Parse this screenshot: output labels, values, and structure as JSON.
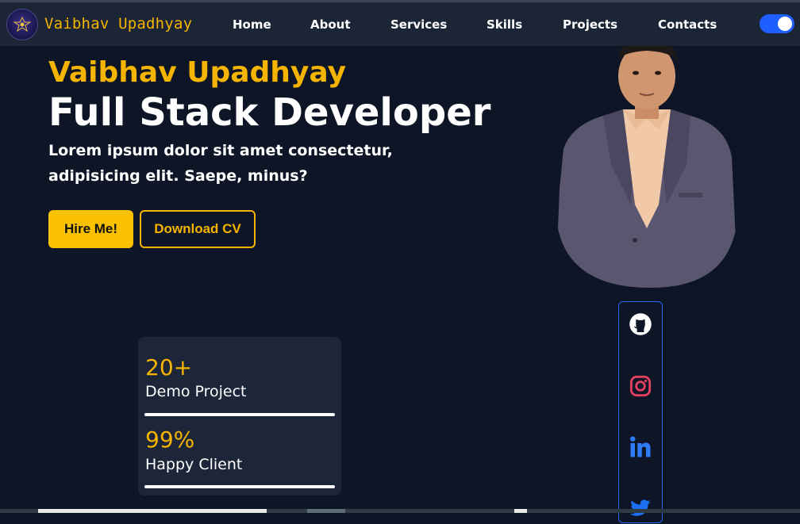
{
  "navbar": {
    "logo_icon": "emblem-logo",
    "brand": "Vaibhav Upadhyay",
    "links": [
      "Home",
      "About",
      "Services",
      "Skills",
      "Projects",
      "Contacts"
    ],
    "theme_toggle": {
      "on": true,
      "color": "#1f5eff"
    }
  },
  "hero": {
    "name": "Vaibhav Upadhyay",
    "title": "Full Stack Developer",
    "description": "Lorem ipsum dolor sit amet consectetur, adipisicing elit. Saepe, minus?",
    "hire_button": "Hire Me!",
    "cv_button": "Download CV"
  },
  "social": {
    "icons": [
      "github-icon",
      "instagram-icon",
      "linkedin-icon",
      "twitter-icon"
    ]
  },
  "stats": [
    {
      "value": "20+",
      "label": "Demo Project"
    },
    {
      "value": "99%",
      "label": "Happy Client"
    }
  ],
  "colors": {
    "accent": "#f5b400",
    "background": "#0d1526",
    "navbar": "#1c2536",
    "card": "#1c2638",
    "social_border": "#2d66ff"
  }
}
